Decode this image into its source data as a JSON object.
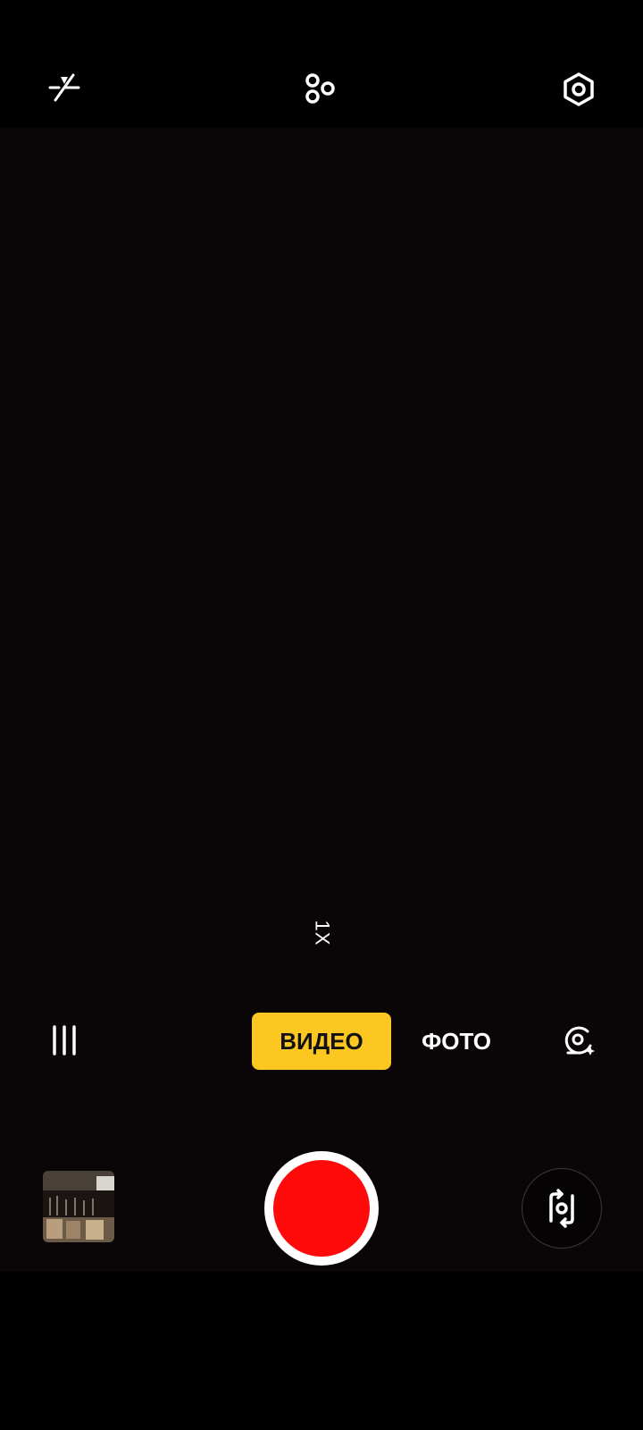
{
  "top_bar": {
    "icons": [
      "flash-off-icon",
      "filters-icon",
      "settings-icon"
    ]
  },
  "viewfinder": {
    "zoom_label": "1X"
  },
  "modes": {
    "video_label": "ВИДЕО",
    "photo_label": "ФОТО",
    "active": "video"
  },
  "controls": {
    "menu_icon": "menu-icon",
    "ai_icon": "ai-scene-icon",
    "shutter_icon": "record-button",
    "flip_icon": "switch-camera-icon"
  },
  "colors": {
    "active_mode_bg": "#fbc720",
    "record": "#ff0a0a",
    "viewfinder_bg": "#0a0507"
  }
}
